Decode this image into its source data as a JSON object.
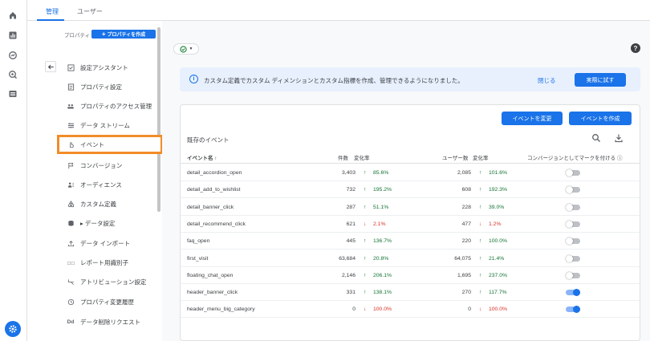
{
  "tabs": [
    {
      "label": "管理"
    },
    {
      "label": "ユーザー"
    }
  ],
  "panel": {
    "property_label": "プロパティ",
    "create_property": "プロパティを作成",
    "items": [
      {
        "label": "設定アシスタント"
      },
      {
        "label": "プロパティ設定"
      },
      {
        "label": "プロパティのアクセス管理"
      },
      {
        "label": "データ ストリーム"
      },
      {
        "label": "イベント"
      },
      {
        "label": "コンバージョン"
      },
      {
        "label": "オーディエンス"
      },
      {
        "label": "カスタム定義"
      },
      {
        "label": "▸ データ設定"
      },
      {
        "label": "データ インポート"
      },
      {
        "label": "レポート用識別子"
      },
      {
        "label": "アトリビューション設定"
      },
      {
        "label": "プロパティ変更履歴"
      },
      {
        "label": "データ削除リクエスト"
      }
    ]
  },
  "banner": {
    "text": "カスタム定義でカスタム ディメンションとカスタム指標を作成、管理できるようになりました。",
    "close": "閉じる",
    "try": "実際に試す"
  },
  "buttons": {
    "modify": "イベントを変更",
    "create": "イベントを作成"
  },
  "table": {
    "title": "既存のイベント",
    "headers": {
      "name": "イベント名 ↑",
      "count": "件数",
      "change1": "変化率",
      "users": "ユーザー数",
      "change2": "変化率",
      "conversion": "コンバージョンとしてマークを付ける ⓘ"
    },
    "rows": [
      {
        "name": "detail_accordion_open",
        "count": "3,403",
        "dir1": "up",
        "pct1": "85.6%",
        "users": "2,085",
        "dir2": "up",
        "pct2": "101.6%",
        "conversion": false
      },
      {
        "name": "detail_add_to_wishlist",
        "count": "732",
        "dir1": "up",
        "pct1": "195.2%",
        "users": "608",
        "dir2": "up",
        "pct2": "192.3%",
        "conversion": false
      },
      {
        "name": "detail_banner_click",
        "count": "287",
        "dir1": "up",
        "pct1": "51.1%",
        "users": "228",
        "dir2": "up",
        "pct2": "39.0%",
        "conversion": false
      },
      {
        "name": "detail_recommend_click",
        "count": "621",
        "dir1": "down",
        "pct1": "2.1%",
        "users": "477",
        "dir2": "down",
        "pct2": "1.2%",
        "conversion": false
      },
      {
        "name": "faq_open",
        "count": "445",
        "dir1": "up",
        "pct1": "136.7%",
        "users": "220",
        "dir2": "up",
        "pct2": "100.0%",
        "conversion": false
      },
      {
        "name": "first_visit",
        "count": "63,684",
        "dir1": "up",
        "pct1": "20.8%",
        "users": "64,075",
        "dir2": "up",
        "pct2": "21.4%",
        "conversion": false
      },
      {
        "name": "floating_chat_open",
        "count": "2,146",
        "dir1": "up",
        "pct1": "206.1%",
        "users": "1,695",
        "dir2": "up",
        "pct2": "237.0%",
        "conversion": false
      },
      {
        "name": "header_banner_click",
        "count": "331",
        "dir1": "up",
        "pct1": "138.1%",
        "users": "270",
        "dir2": "up",
        "pct2": "117.7%",
        "conversion": true
      },
      {
        "name": "header_menu_big_category",
        "count": "0",
        "dir1": "down",
        "pct1": "100.0%",
        "users": "0",
        "dir2": "down",
        "pct2": "100.0%",
        "conversion": true
      }
    ]
  },
  "icons": {
    "up": "↑",
    "down": "↓"
  },
  "colors": {
    "accent": "#1a73e8",
    "highlight": "#f28c28",
    "up": "#137333",
    "down": "#d93025"
  }
}
